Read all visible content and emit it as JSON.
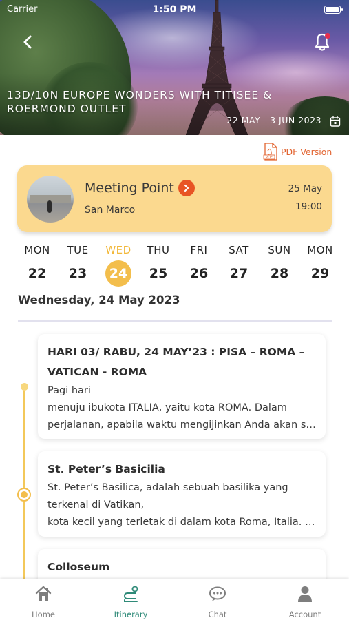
{
  "status_bar": {
    "carrier": "Carrier",
    "time": "1:50 PM"
  },
  "tour": {
    "title": "13D/10N EUROPE WONDERS WITH TITISEE & ROERMOND OUTLET",
    "dates": "22 MAY - 3 JUN 2023"
  },
  "pdf": {
    "label": "PDF Version",
    "icon_text": "PDF"
  },
  "meeting": {
    "title": "Meeting Point",
    "place": "San Marco",
    "date": "25 May",
    "time": "19:00"
  },
  "days": [
    {
      "name": "MON",
      "num": "22"
    },
    {
      "name": "TUE",
      "num": "23"
    },
    {
      "name": "WED",
      "num": "24",
      "active": true
    },
    {
      "name": "THU",
      "num": "25"
    },
    {
      "name": "FRI",
      "num": "26"
    },
    {
      "name": "SAT",
      "num": "27"
    },
    {
      "name": "SUN",
      "num": "28"
    },
    {
      "name": "MON",
      "num": "29"
    }
  ],
  "selected_date": "Wednesday, 24 May 2023",
  "itinerary": [
    {
      "title_line1": "HARI 03/ RABU, 24 MAY’23 : PISA – ROMA –",
      "title_line2": "VATICAN - ROMA",
      "lines": [
        "Pagi hari",
        "menuju ibukota ITALIA, yaitu kota ROMA. Dalam",
        "perjalanan, apabila waktu mengijinkan Anda akan sing..."
      ]
    },
    {
      "title_line1": "St. Peter’s Basicilia",
      "lines": [
        "St. Peter’s Basilica, adalah sebuah basilika yang",
        "terkenal di Vatikan,",
        "kota kecil yang terletak di dalam kota Roma, Italia. Ba..."
      ]
    },
    {
      "title_line1": "Colloseum"
    }
  ],
  "nav": {
    "items": [
      {
        "label": "Home",
        "icon": "home-icon"
      },
      {
        "label": "Itinerary",
        "icon": "route-icon",
        "active": true
      },
      {
        "label": "Chat",
        "icon": "chat-icon"
      },
      {
        "label": "Account",
        "icon": "account-icon"
      }
    ]
  },
  "colors": {
    "accent_yellow": "#f3be4c",
    "meeting_card": "#fbd98f",
    "pdf_orange": "#e2632f",
    "nav_active": "#2f8a78"
  }
}
